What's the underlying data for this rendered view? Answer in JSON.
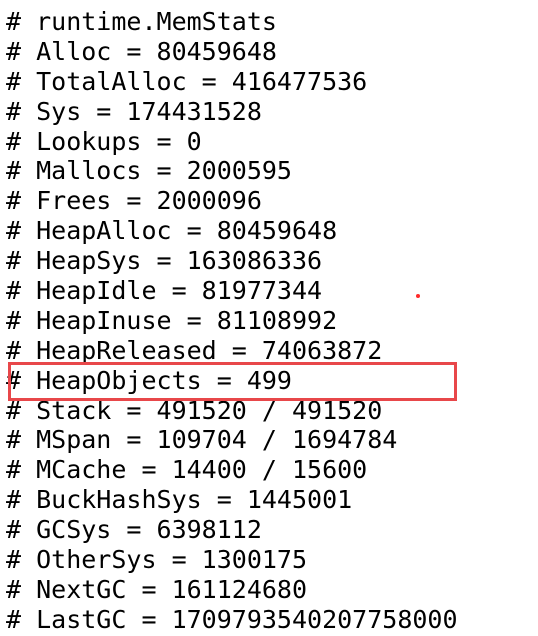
{
  "lines": [
    "# runtime.MemStats",
    "# Alloc = 80459648",
    "# TotalAlloc = 416477536",
    "# Sys = 174431528",
    "# Lookups = 0",
    "# Mallocs = 2000595",
    "# Frees = 2000096",
    "# HeapAlloc = 80459648",
    "# HeapSys = 163086336",
    "# HeapIdle = 81977344",
    "# HeapInuse = 81108992",
    "# HeapReleased = 74063872",
    "# HeapObjects = 499",
    "# Stack = 491520 / 491520",
    "# MSpan = 109704 / 1694784",
    "# MCache = 14400 / 15600",
    "# BuckHashSys = 1445001",
    "# GCSys = 6398112",
    "# OtherSys = 1300175",
    "# NextGC = 161124680",
    "# LastGC = 1709793540207758000"
  ],
  "highlight_color": "#e8474a"
}
